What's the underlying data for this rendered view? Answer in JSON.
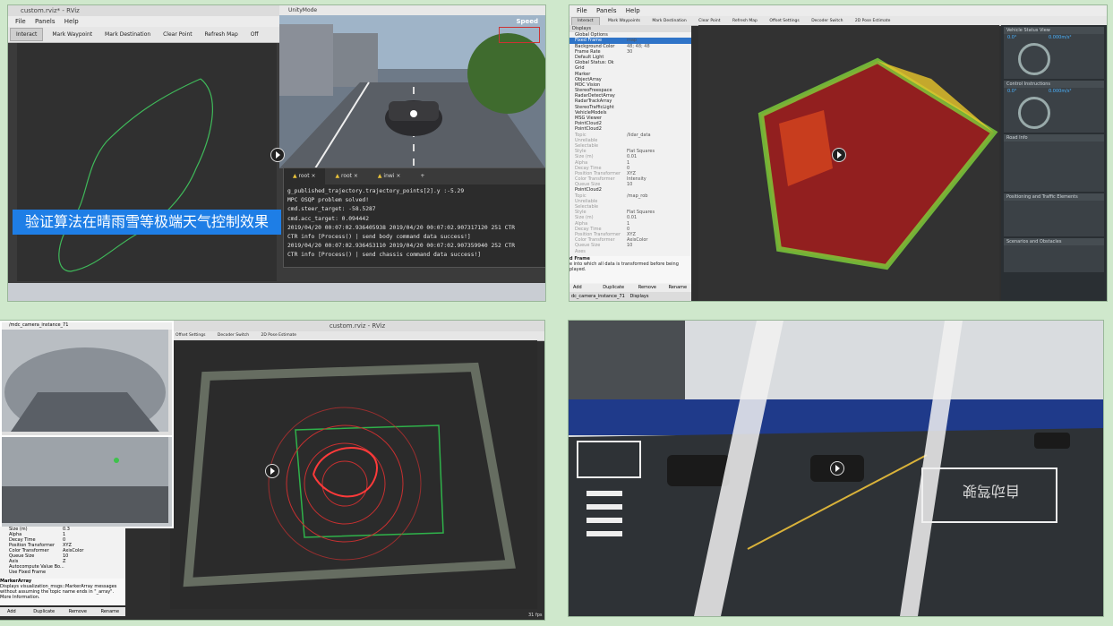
{
  "panel1": {
    "window_title": "custom.rviz* - RViz",
    "menu": [
      "File",
      "Panels",
      "Help"
    ],
    "toolbar": [
      "Interact",
      "Mark Waypoint",
      "Mark Destination",
      "Clear Point",
      "Refresh Map",
      "Off"
    ],
    "unity_title": "UnityMode",
    "speed_label": "Speed",
    "terminal_tabs": [
      "root",
      "root",
      "inwi"
    ],
    "terminal_lines": [
      "g_published_trajectory.trajectory_points[2].y :-5.29",
      "MPC OSQP problem solved!",
      "cmd.steer_target: -58.5287",
      "cmd.acc_target: 0.094442",
      "2019/04/20 00:07:02.936405938 2019/04/20 00:07:02.907317120 251 CTR",
      "CTR info [Process() | send body command data success!]",
      "2019/04/20 00:07:02.936453110 2019/04/20 00:07:02.907359940 252 CTR",
      "CTR info [Process() | send chassis command data success!]"
    ],
    "caption": "验证算法在晴雨雪等极端天气控制效果"
  },
  "panel2": {
    "menu": [
      "File",
      "Panels",
      "Help"
    ],
    "toolbar": [
      "Interact",
      "Mark Waypoints",
      "Mark Destination",
      "Clear Point",
      "Refresh Map",
      "Offset Settings",
      "Decoder Switch",
      "2D Pose Estimate"
    ],
    "displays_title": "Displays",
    "display_rows": [
      {
        "label": "Global Options",
        "value": ""
      },
      {
        "label": "Fixed Frame",
        "value": "map"
      },
      {
        "label": "Background Color",
        "value": "48; 48; 48"
      },
      {
        "label": "Frame Rate",
        "value": "30"
      },
      {
        "label": "Default Light",
        "value": ""
      },
      {
        "label": "Global Status: Ok",
        "value": ""
      },
      {
        "label": "Grid",
        "value": ""
      },
      {
        "label": "Marker",
        "value": ""
      },
      {
        "label": "ObjectArray",
        "value": ""
      },
      {
        "label": "MDC Vision",
        "value": ""
      },
      {
        "label": "StereoFreespace",
        "value": ""
      },
      {
        "label": "RadarDetectArray",
        "value": ""
      },
      {
        "label": "RadarTrackArray",
        "value": ""
      },
      {
        "label": "StereoTrafficLight",
        "value": ""
      },
      {
        "label": "VehicleModels",
        "value": ""
      },
      {
        "label": "MSG Viewer",
        "value": ""
      },
      {
        "label": "PointCloud2",
        "value": ""
      },
      {
        "label": "PointCloud2",
        "value": ""
      },
      {
        "label": "Topic",
        "value": "/lidar_data"
      },
      {
        "label": "Unreliable",
        "value": ""
      },
      {
        "label": "Selectable",
        "value": ""
      },
      {
        "label": "Style",
        "value": "Flat Squares"
      },
      {
        "label": "Size (m)",
        "value": "0.01"
      },
      {
        "label": "Alpha",
        "value": "1"
      },
      {
        "label": "Decay Time",
        "value": "0"
      },
      {
        "label": "Position Transformer",
        "value": "XYZ"
      },
      {
        "label": "Color Transformer",
        "value": "Intensity"
      },
      {
        "label": "Queue Size",
        "value": "10"
      },
      {
        "label": "PointCloud2",
        "value": ""
      },
      {
        "label": "Topic",
        "value": "/map_rob"
      },
      {
        "label": "Unreliable",
        "value": ""
      },
      {
        "label": "Selectable",
        "value": ""
      },
      {
        "label": "Style",
        "value": "Flat Squares"
      },
      {
        "label": "Size (m)",
        "value": "0.01"
      },
      {
        "label": "Alpha",
        "value": "1"
      },
      {
        "label": "Decay Time",
        "value": "0"
      },
      {
        "label": "Position Transformer",
        "value": "XYZ"
      },
      {
        "label": "Color Transformer",
        "value": "AxisColor"
      },
      {
        "label": "Queue Size",
        "value": "10"
      },
      {
        "label": "Axes",
        "value": ""
      }
    ],
    "frame_help_title": "d Frame",
    "frame_help_text": "e into which all data is transformed before being played.",
    "buttons": [
      "Add",
      "Duplicate",
      "Remove",
      "Rename"
    ],
    "bottom_tabs": [
      "dc_camera_instance_71",
      "Displays"
    ],
    "right_sections": [
      "Vehicle Status View",
      "Control Instructions",
      "Road Info",
      "Positioning and Traffic Elements",
      "Scenarios and Obstacles"
    ],
    "vehicle_values": [
      "0.0°",
      "0.000m/s²"
    ],
    "control_values": [
      "0.0°",
      "0.000m/s²"
    ]
  },
  "panel3": {
    "camera_title": "/mdc_camera_instance_71",
    "window_title": "custom.rviz - RViz",
    "toolbar": [
      "Offset Settings",
      "Decoder Switch",
      "2D Pose Estimate"
    ],
    "props": [
      {
        "label": "Size (m)",
        "value": "0.3"
      },
      {
        "label": "Alpha",
        "value": "1"
      },
      {
        "label": "Decay Time",
        "value": "0"
      },
      {
        "label": "Position Transformer",
        "value": "XYZ"
      },
      {
        "label": "Color Transformer",
        "value": "AxisColor"
      },
      {
        "label": "Queue Size",
        "value": "10"
      },
      {
        "label": "Axis",
        "value": "Z"
      },
      {
        "label": "Autocompute Value Bo...",
        "value": ""
      },
      {
        "label": "Use Fixed Frame",
        "value": ""
      }
    ],
    "marker_title": "MarkerArray",
    "marker_help": "Displays visualization_msgs::MarkerArray messages without assuming the topic name ends in \"_array\". More Information.",
    "buttons": [
      "Add",
      "Duplicate",
      "Remove",
      "Rename"
    ],
    "fps": "31 fps",
    "reset": "Reset"
  },
  "panel4": {
    "floor_text": "自动驾驶"
  }
}
